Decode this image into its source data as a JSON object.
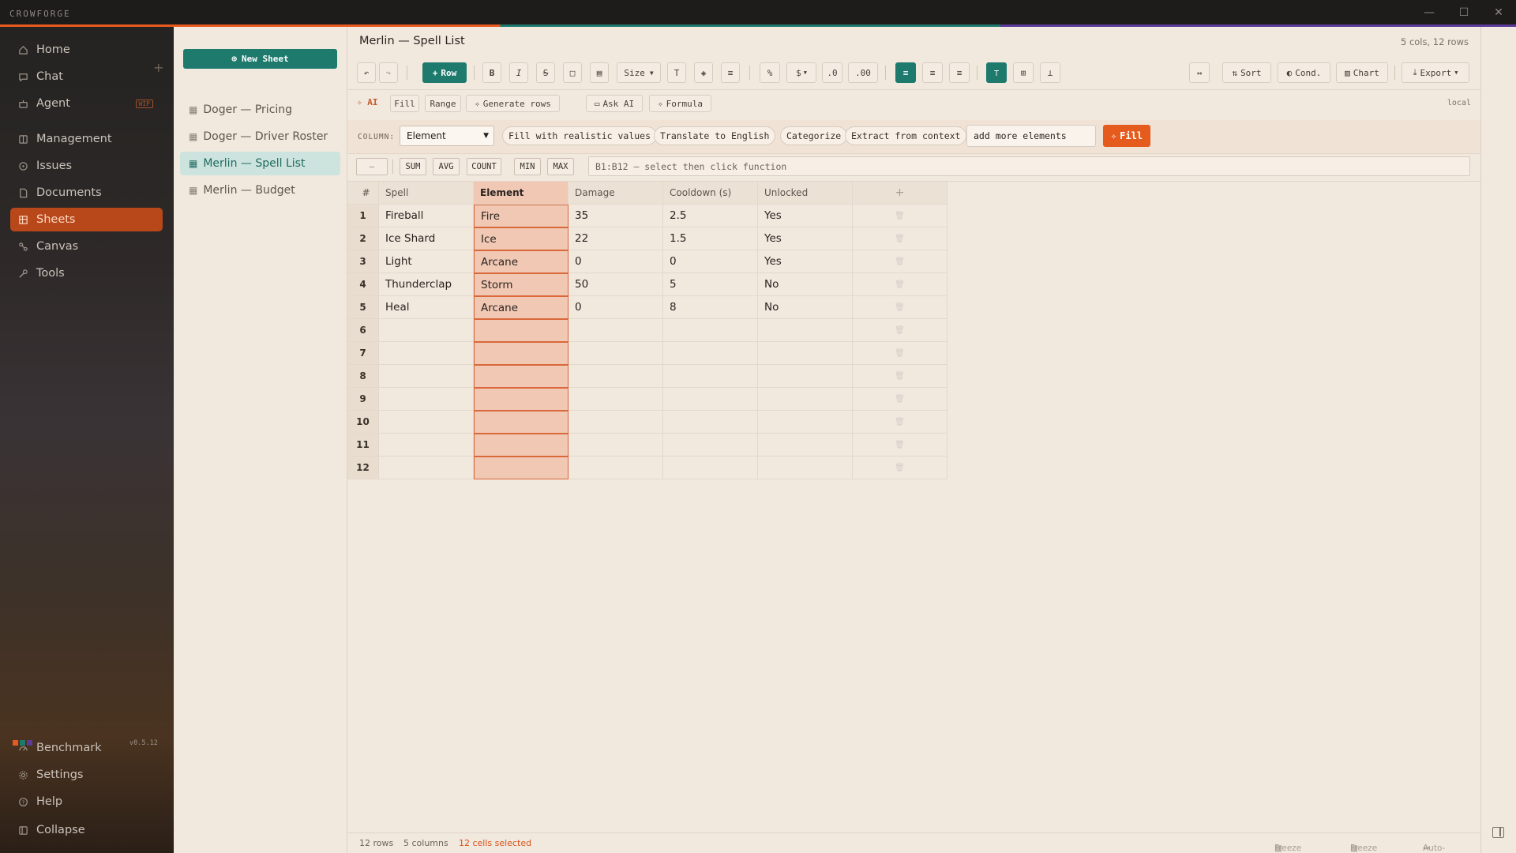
{
  "app": {
    "name": "CROWFORGE",
    "version": "v0.5.12",
    "window_controls": [
      "—",
      "☐",
      "✕"
    ]
  },
  "sidebar": {
    "items": [
      {
        "label": "Home",
        "icon": "home-icon"
      },
      {
        "label": "Chat",
        "icon": "chat-icon"
      },
      {
        "label": "Agent",
        "icon": "agent-icon",
        "badge": "WIP"
      },
      {
        "label": "Management",
        "icon": "management-icon"
      },
      {
        "label": "Issues",
        "icon": "issues-icon"
      },
      {
        "label": "Documents",
        "icon": "documents-icon"
      },
      {
        "label": "Sheets",
        "icon": "sheets-icon",
        "active": true
      },
      {
        "label": "Canvas",
        "icon": "canvas-icon"
      },
      {
        "label": "Tools",
        "icon": "tools-icon"
      }
    ],
    "bottom": [
      {
        "label": "Benchmark",
        "icon": "benchmark-icon"
      },
      {
        "label": "Settings",
        "icon": "settings-icon"
      },
      {
        "label": "Help",
        "icon": "help-icon"
      },
      {
        "label": "Collapse",
        "icon": "collapse-icon"
      }
    ],
    "swatch_colors": [
      "#e55b1d",
      "#1f7a6e",
      "#5b3a99"
    ]
  },
  "sheets": {
    "new_label": "New Sheet",
    "items": [
      {
        "label": "Doger — Pricing"
      },
      {
        "label": "Doger — Driver Roster"
      },
      {
        "label": "Merlin — Spell List",
        "active": true
      },
      {
        "label": "Merlin — Budget"
      }
    ]
  },
  "main": {
    "title": "Merlin — Spell List",
    "dims": "5 cols, 12 rows",
    "toolbar": {
      "row_label": "Row",
      "size_label": "Size",
      "sort_label": "Sort",
      "cond_label": "Cond.",
      "chart_label": "Chart",
      "export_label": "Export",
      "percent": "%",
      "currency": "$",
      "dec_less": ".0",
      "dec_more": ".00"
    },
    "ai_bar": {
      "ai_label": "AI",
      "modes": [
        "Fill",
        "Range",
        "Generate rows",
        "Ask AI",
        "Formula"
      ],
      "local": "local"
    },
    "column_bar": {
      "label": "COLUMN:",
      "selected": "Element",
      "chips": [
        "Fill with realistic values",
        "Translate to English",
        "Categorize",
        "Extract from context"
      ],
      "instruction": "add more elements",
      "fill_label": "Fill"
    },
    "functions": {
      "dash": "—",
      "items": [
        "SUM",
        "AVG",
        "COUNT",
        "MIN",
        "MAX"
      ],
      "formula_text": "B1:B12 — select then click function"
    },
    "table": {
      "index_header": "#",
      "columns": [
        "Spell",
        "Element",
        "Damage",
        "Cooldown (s)",
        "Unlocked"
      ],
      "add_col": "+",
      "selected_column": 1,
      "rows": [
        [
          "Fireball",
          "Fire",
          "35",
          "2.5",
          "Yes"
        ],
        [
          "Ice Shard",
          "Ice",
          "22",
          "1.5",
          "Yes"
        ],
        [
          "Light",
          "Arcane",
          "0",
          "0",
          "Yes"
        ],
        [
          "Thunderclap",
          "Storm",
          "50",
          "5",
          "No"
        ],
        [
          "Heal",
          "Arcane",
          "0",
          "8",
          "No"
        ],
        [
          "",
          "",
          "",
          "",
          ""
        ],
        [
          "",
          "",
          "",
          "",
          ""
        ],
        [
          "",
          "",
          "",
          "",
          ""
        ],
        [
          "",
          "",
          "",
          "",
          ""
        ],
        [
          "",
          "",
          "",
          "",
          ""
        ],
        [
          "",
          "",
          "",
          "",
          ""
        ],
        [
          "",
          "",
          "",
          "",
          ""
        ]
      ]
    },
    "status": {
      "rows": "12 rows",
      "columns": "5 columns",
      "selected": "12 cells selected",
      "freeze_row": "Freeze row",
      "freeze_col": "Freeze col",
      "autofit": "Auto-fit"
    }
  }
}
